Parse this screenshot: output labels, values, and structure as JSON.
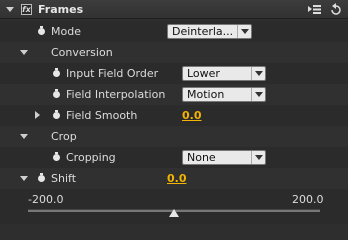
{
  "effect": {
    "title": "Frames",
    "fx_glyph": "fx",
    "icons": [
      "menu-icon",
      "reset-icon"
    ]
  },
  "properties": {
    "mode": {
      "label": "Mode",
      "value": "Deinterla..."
    },
    "conversion": {
      "label": "Conversion"
    },
    "input_field_order": {
      "label": "Input Field Order",
      "value": "Lower"
    },
    "field_interpolation": {
      "label": "Field Interpolation",
      "value": "Motion"
    },
    "field_smooth": {
      "label": "Field Smooth",
      "value": "0.0"
    },
    "crop": {
      "label": "Crop"
    },
    "cropping": {
      "label": "Cropping",
      "value": "None"
    },
    "shift": {
      "label": "Shift",
      "value": "0.0",
      "slider_min": "-200.0",
      "slider_max": "200.0",
      "slider_fraction": 0.5
    }
  }
}
